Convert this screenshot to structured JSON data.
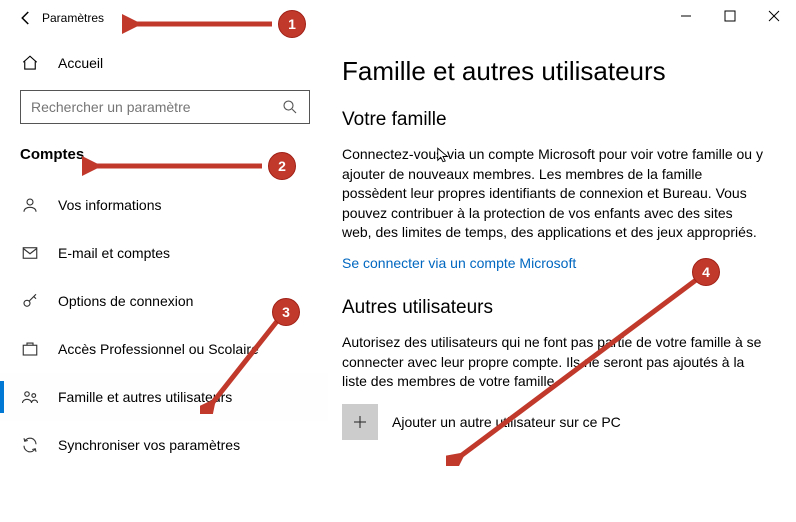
{
  "window": {
    "title": "Paramètres"
  },
  "sidebar": {
    "home": "Accueil",
    "search_placeholder": "Rechercher un paramètre",
    "section": "Comptes",
    "items": [
      {
        "label": "Vos informations"
      },
      {
        "label": "E-mail et comptes"
      },
      {
        "label": "Options de connexion"
      },
      {
        "label": "Accès Professionnel ou Scolaire"
      },
      {
        "label": "Famille et autres utilisateurs"
      },
      {
        "label": "Synchroniser vos paramètres"
      }
    ]
  },
  "main": {
    "title": "Famille et autres utilisateurs",
    "family_heading": "Votre famille",
    "family_body": "Connectez-vous via un compte Microsoft pour voir votre famille ou y ajouter de nouveaux membres. Les membres de la famille possèdent leur propres identifiants de connexion et Bureau. Vous pouvez contribuer à la protection de vos enfants avec des sites web, des limites de temps, des applications et des jeux appropriés.",
    "family_link": "Se connecter via un compte Microsoft",
    "others_heading": "Autres utilisateurs",
    "others_body": "Autorisez des utilisateurs qui ne font pas partie de votre famille à se connecter avec leur propre compte. Ils ne seront pas ajoutés à la liste des membres de votre famille.",
    "add_label": "Ajouter un autre utilisateur sur ce PC"
  },
  "annotations": {
    "b1": "1",
    "b2": "2",
    "b3": "3",
    "b4": "4"
  }
}
